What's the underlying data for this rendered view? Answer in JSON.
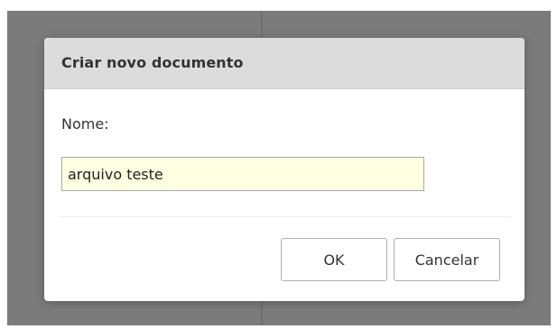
{
  "dialog": {
    "title": "Criar novo documento",
    "name_label": "Nome:",
    "name_value": "arquivo teste",
    "ok_label": "OK",
    "cancel_label": "Cancelar"
  },
  "colors": {
    "overlay": "#7b7b7b",
    "header_bg": "#dcdcdc",
    "input_bg": "#ffffe1"
  }
}
